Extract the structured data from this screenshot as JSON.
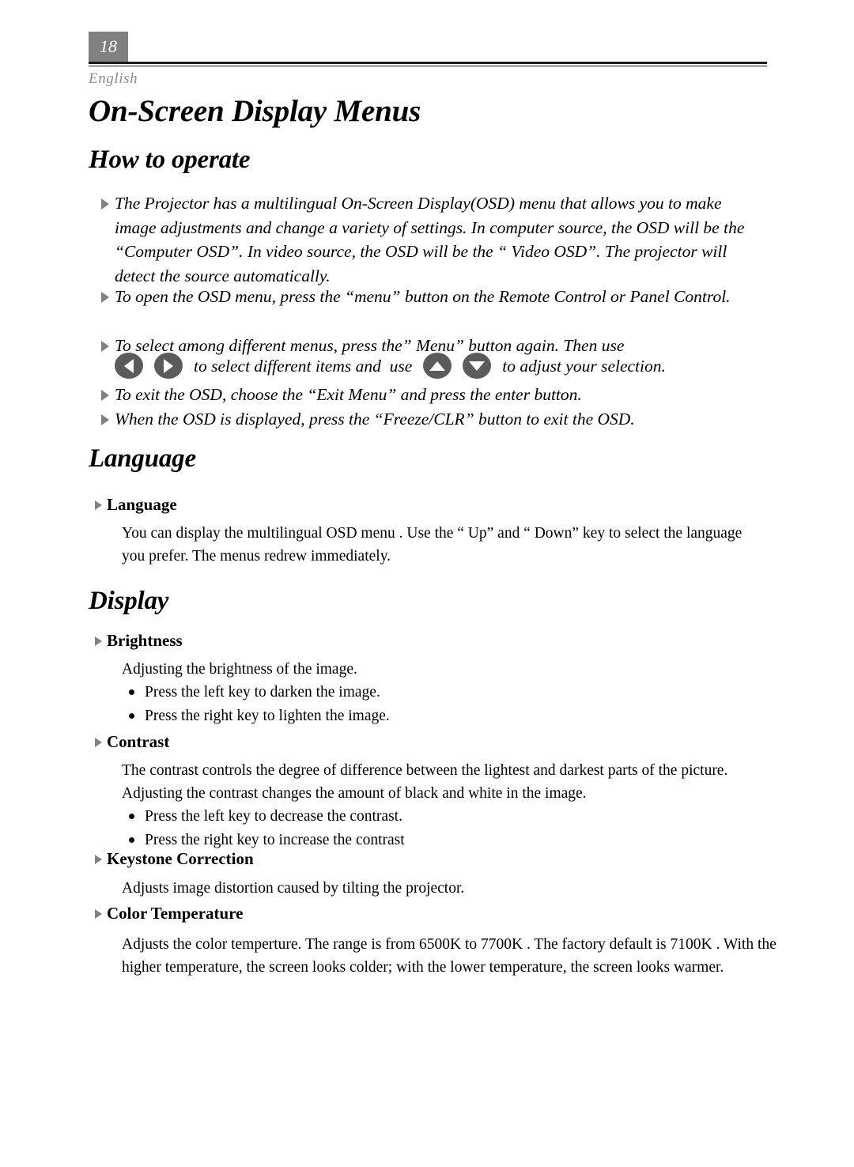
{
  "header": {
    "page_number": "18",
    "language_label": "English"
  },
  "doc_title": "On-Screen Display Menus",
  "sections": {
    "how_to_operate": {
      "title": "How to operate",
      "bullets": [
        "The Projector has a multilingual On-Screen Display(OSD) menu that allows you to make image adjustments and change a variety of settings. In computer source, the OSD will be the “Computer OSD”. In video source, the OSD will be the “ Video OSD”. The projector will detect the source automatically.",
        "To open the OSD menu, press the “menu” button on the Remote Control or Panel Control.",
        "To select among different menus, press the” Menu” button again. Then  use",
        "To exit the OSD, choose the “Exit Menu” and press the enter button.",
        "When the OSD is displayed, press the “Freeze/CLR” button to exit the OSD."
      ],
      "keys_row": {
        "middle_text": "to select different items and  use",
        "end_text": "to adjust your selection.",
        "buttons": [
          "left-arrow-button",
          "right-arrow-button",
          "up-arrow-button",
          "down-arrow-button"
        ]
      }
    },
    "language": {
      "title": "Language",
      "subsection": {
        "heading": "Language",
        "body": "You can display the multilingual OSD menu . Use the “ Up” and “ Down” key to select the language you prefer. The menus redrew immediately."
      }
    },
    "display": {
      "title": "Display",
      "subsections": [
        {
          "heading": "Brightness",
          "body": "Adjusting the brightness of the image.",
          "bullets": [
            "Press the left key to darken the image.",
            "Press the right key to lighten the image."
          ]
        },
        {
          "heading": "Contrast",
          "body": "The contrast controls the degree of difference between the lightest and darkest parts of  the picture. Adjusting  the contrast changes the amount of black and white in the image.",
          "bullets": [
            "Press the left key to decrease the contrast.",
            "Press the right key to increase the contrast"
          ]
        },
        {
          "heading": "Keystone Correction",
          "body": "Adjusts image distortion caused by tilting the projector.",
          "bullets": []
        },
        {
          "heading": "Color Temperature",
          "body": "Adjusts the color temperture. The range is from 6500K to 7700K . The factory default is 7100K . With the higher temperature, the screen looks colder; with the lower temperature, the screen looks warmer.",
          "bullets": []
        }
      ]
    }
  },
  "colors": {
    "page_number_box": "#808080",
    "rule": "#1a1a1a",
    "language_label": "#8c8c8c",
    "bullet_marker": "#808080",
    "key_button": "#5b5b5b",
    "key_arrow": "#ffffff"
  }
}
